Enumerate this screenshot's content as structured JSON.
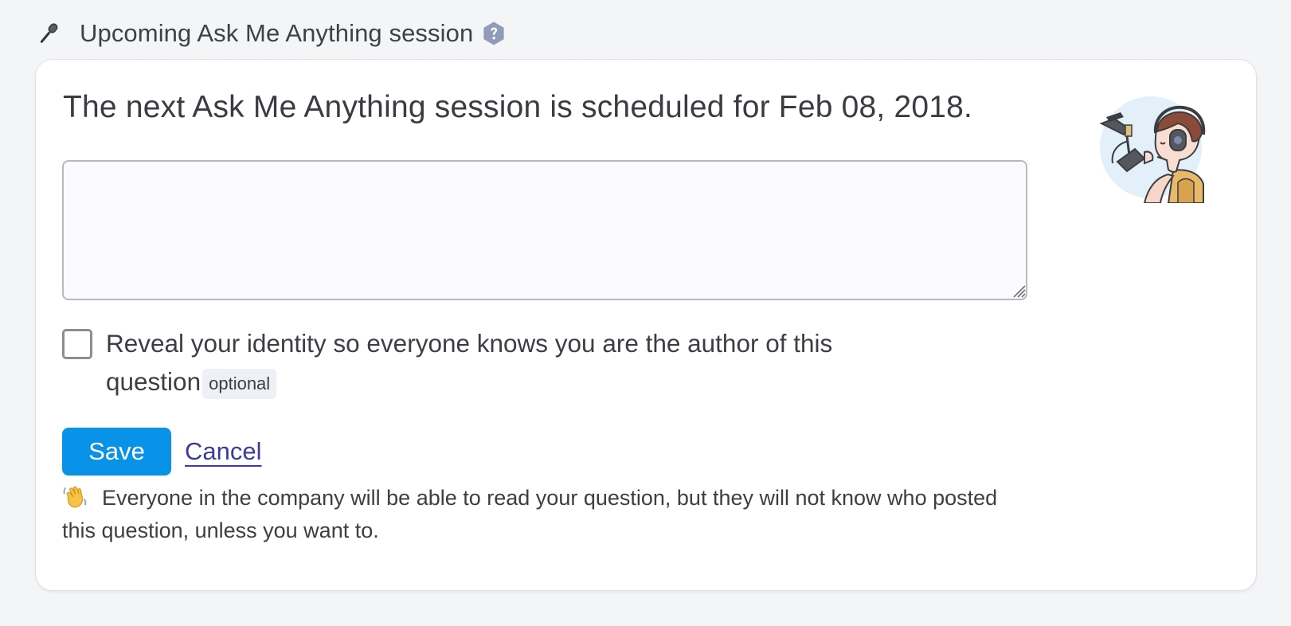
{
  "section": {
    "icon": "microphone-icon",
    "title": "Upcoming Ask Me Anything session",
    "help_icon": "question-circle-icon"
  },
  "card": {
    "heading": "The next Ask Me Anything session is scheduled for Feb 08, 2018.",
    "illustration": "podcaster-illustration",
    "question_field": {
      "value": "",
      "placeholder": ""
    },
    "reveal_identity": {
      "checked": false,
      "label": "Reveal your identity so everyone knows you are the author of this question",
      "badge": "optional"
    },
    "actions": {
      "save_label": "Save",
      "cancel_label": "Cancel"
    },
    "note": {
      "icon": "waving-hand-icon",
      "text": "Everyone in the company will be able to read your question, but they will not know who posted this question, unless you want to."
    }
  },
  "colors": {
    "page_background": "#f4f5f7",
    "card_background": "#ffffff",
    "primary_button": "#0893e8",
    "link": "#3d3a9e",
    "badge_background": "#eef0f6",
    "help_icon": "#8f9bb8"
  }
}
